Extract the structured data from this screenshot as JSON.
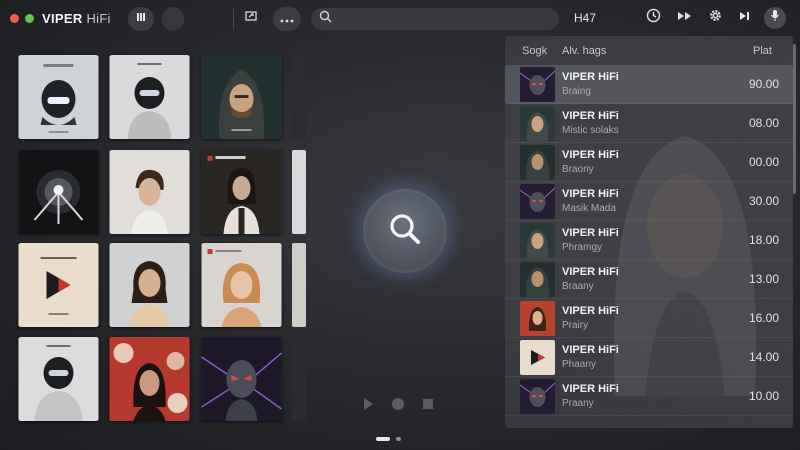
{
  "app": {
    "name": "VIPER",
    "name_suffix": "HiFi"
  },
  "topbar": {
    "search": {
      "value": "",
      "placeholder": ""
    },
    "label": "H47",
    "icons": [
      "pause-icon",
      "more-icon",
      "search-icon",
      "history-icon",
      "forward-icon",
      "gear-icon",
      "skip-icon",
      "mic-icon"
    ]
  },
  "colors": {
    "close_dot": "#ec5f4f",
    "zoom_dot": "#5ec44f",
    "glow": "#6e96dc"
  },
  "albums": [
    {
      "style": "helmet-light"
    },
    {
      "style": "helmet-person"
    },
    {
      "style": "hooded-man"
    },
    {
      "style": "dark-orb"
    },
    {
      "style": "boy-portrait"
    },
    {
      "style": "dark-girl"
    },
    {
      "style": "red-logo"
    },
    {
      "style": "woman-portrait"
    },
    {
      "style": "blonde-woman"
    },
    {
      "style": "helmet-person-2"
    },
    {
      "style": "red-floral-woman"
    },
    {
      "style": "robot-neon"
    }
  ],
  "list": {
    "headers": {
      "col1": "Sogk",
      "col2": "Alv. hags",
      "col3": "Plat"
    },
    "rows": [
      {
        "title": "VIPER HiFi",
        "subtitle": "Braing",
        "value": "90.00",
        "thumb": "robot-neon"
      },
      {
        "title": "VIPER HiFi",
        "subtitle": "Mistic solaks",
        "value": "08.00",
        "thumb": "hooded-man"
      },
      {
        "title": "VIPER HiFi",
        "subtitle": "Braony",
        "value": "00.00",
        "thumb": "hooded-man-2"
      },
      {
        "title": "VIPER HiFi",
        "subtitle": "Masik Mada",
        "value": "30.00",
        "thumb": "robot-neon"
      },
      {
        "title": "VIPER HiFi",
        "subtitle": "Phramgy",
        "value": "18.00",
        "thumb": "hooded-man"
      },
      {
        "title": "VIPER HiFi",
        "subtitle": "Braany",
        "value": "13.00",
        "thumb": "hooded-man-2"
      },
      {
        "title": "VIPER HiFi",
        "subtitle": "Prairy",
        "value": "16.00",
        "thumb": "red-portrait"
      },
      {
        "title": "VIPER HiFi",
        "subtitle": "Phaany",
        "value": "14.00",
        "thumb": "red-logo"
      },
      {
        "title": "VIPER HiFi",
        "subtitle": "Praany",
        "value": "10.00",
        "thumb": "robot-neon"
      }
    ]
  }
}
